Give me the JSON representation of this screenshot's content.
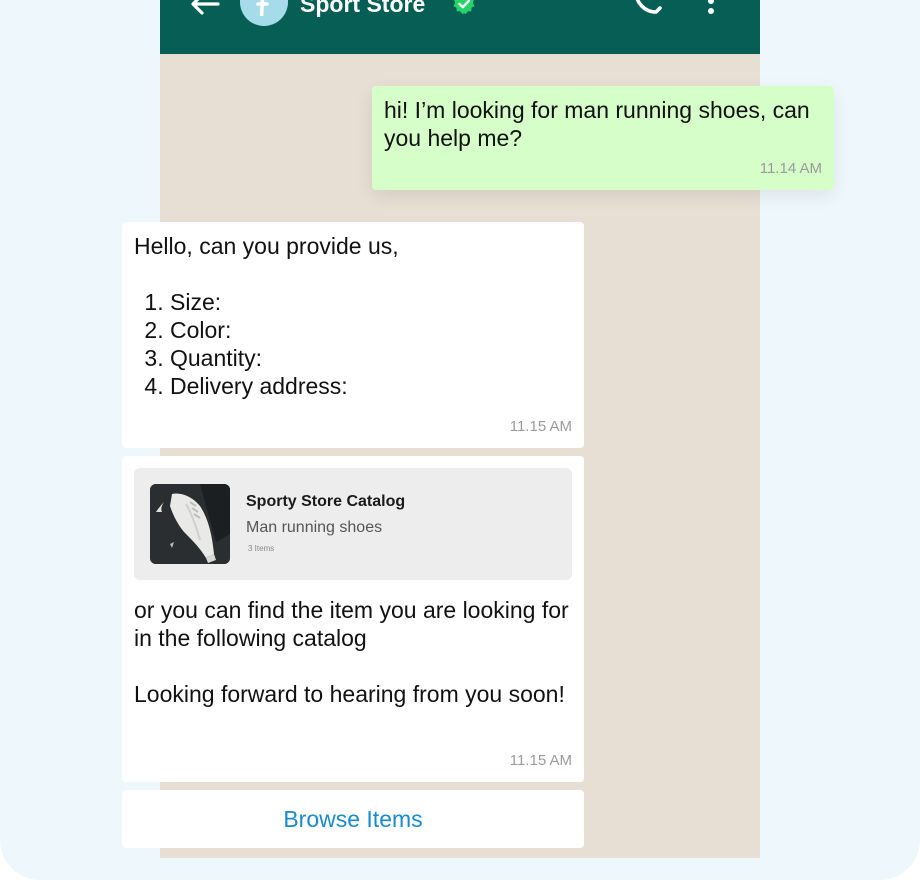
{
  "header": {
    "store_name": "Sport Store",
    "avatar_letter": "f",
    "bg_color": "#075e54"
  },
  "messages": {
    "outgoing": {
      "text": "hi! I’m looking for man running shoes, can you help me?",
      "time": "11.14 AM",
      "bg_color": "#d6fec9"
    },
    "incoming_1": {
      "intro": "Hello, can you provide us,",
      "items": [
        "Size:",
        "Color:",
        "Quantity:",
        "Delivery address:"
      ],
      "time": "11.15 AM"
    },
    "incoming_2": {
      "catalog": {
        "title": "Sporty Store Catalog",
        "subtitle": "Man running shoes",
        "count": "3 Items"
      },
      "text": "or you can find the item you are looking for in the following catalog\n\nLooking forward to hearing from you soon!",
      "time": "11.15 AM"
    }
  },
  "actions": {
    "browse_label": "Browse Items",
    "accent_color": "#1a8ad0"
  },
  "icons": [
    "back-arrow-icon",
    "verified-badge-icon",
    "phone-call-icon",
    "more-vertical-icon",
    "sneaker-thumbnail"
  ]
}
